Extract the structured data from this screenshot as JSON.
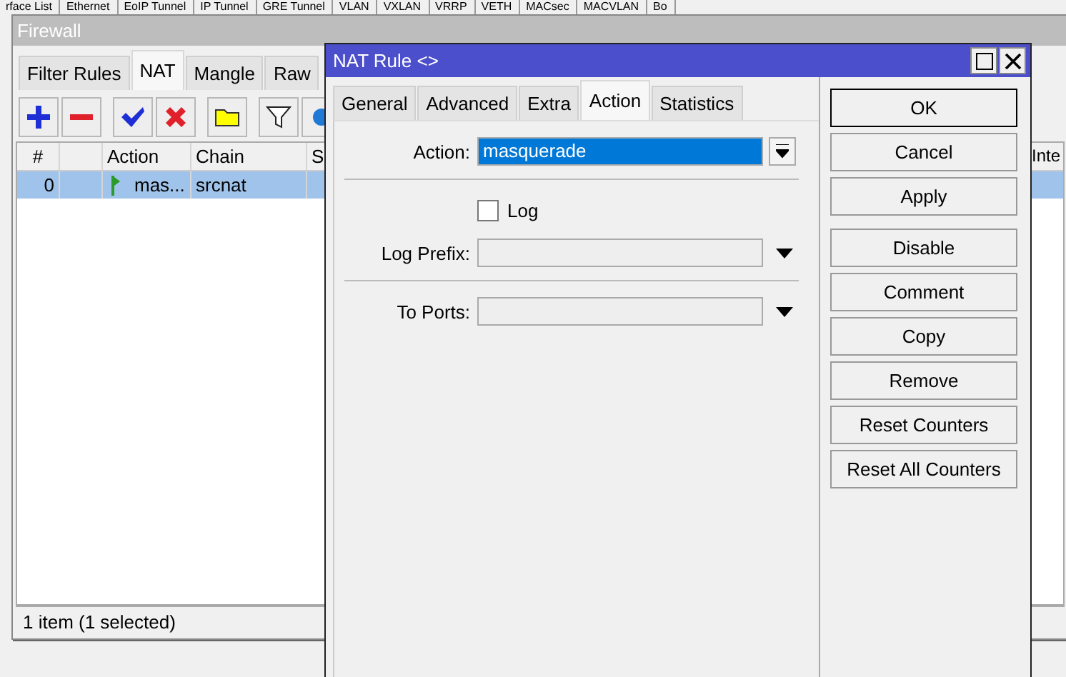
{
  "background_tabs": [
    "rface List",
    "Ethernet",
    "EoIP Tunnel",
    "IP Tunnel",
    "GRE Tunnel",
    "VLAN",
    "VXLAN",
    "VRRP",
    "VETH",
    "MACsec",
    "MACVLAN",
    "Bo"
  ],
  "firewall": {
    "title": "Firewall",
    "tabs": [
      {
        "label": "Filter Rules",
        "selected": false
      },
      {
        "label": "NAT",
        "selected": true
      },
      {
        "label": "Mangle",
        "selected": false
      },
      {
        "label": "Raw",
        "selected": false
      }
    ],
    "table": {
      "columns": [
        "#",
        "Action",
        "Chain",
        "S"
      ],
      "cut_column": "Inte",
      "rows": [
        {
          "number": "0",
          "action": "mas...",
          "chain": "srcnat",
          "selected": true
        }
      ]
    },
    "status_bar": "1 item (1 selected)"
  },
  "dialog": {
    "title": "NAT Rule <>",
    "tabs": [
      {
        "label": "General",
        "selected": false
      },
      {
        "label": "Advanced",
        "selected": false
      },
      {
        "label": "Extra",
        "selected": false
      },
      {
        "label": "Action",
        "selected": true
      },
      {
        "label": "Statistics",
        "selected": false
      }
    ],
    "action": {
      "label": "Action:",
      "value": "masquerade"
    },
    "log": {
      "label": "Log",
      "checked": false
    },
    "log_prefix": {
      "label": "Log Prefix:"
    },
    "to_ports": {
      "label": "To Ports:"
    },
    "buttons": [
      {
        "label": "OK",
        "default": true
      },
      {
        "label": "Cancel",
        "default": false
      },
      {
        "label": "Apply",
        "default": false
      }
    ],
    "rule_buttons": [
      {
        "label": "Disable"
      },
      {
        "label": "Comment"
      },
      {
        "label": "Copy"
      },
      {
        "label": "Remove"
      },
      {
        "label": "Reset Counters"
      },
      {
        "label": "Reset All Counters"
      }
    ]
  }
}
